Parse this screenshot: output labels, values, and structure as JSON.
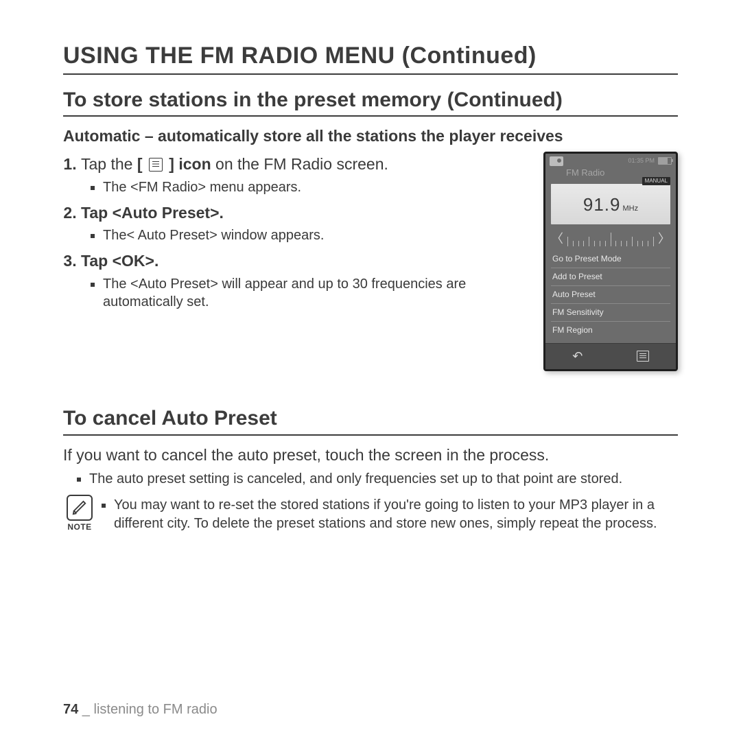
{
  "headings": {
    "page_title": "USING THE FM RADIO MENU (Continued)",
    "section1": "To store stations in the preset memory (Continued)",
    "section2": "To cancel Auto Preset"
  },
  "mode_line": "Automatic – automatically store all the stations the player receives",
  "steps": {
    "s1": {
      "num": "1.",
      "pre": "Tap the ",
      "icon_word": "icon",
      "bracket_open": "[",
      "bracket_close": "]",
      "post": " on the FM Radio screen.",
      "sub": "The <FM Radio> menu appears."
    },
    "s2": {
      "num": "2.",
      "main_a": "Tap ",
      "main_b": "<Auto Preset>",
      "main_c": ".",
      "sub": "The< Auto Preset> window appears."
    },
    "s3": {
      "num": "3.",
      "main_a": "Tap ",
      "main_b": "<OK>",
      "main_c": ".",
      "sub": "The <Auto Preset> will appear and up to 30 frequencies are automatically set."
    }
  },
  "cancel": {
    "body": "If you want to cancel the auto preset, touch the screen in the process.",
    "sub": "The auto preset setting is canceled, and only frequencies set up to that point are stored."
  },
  "note": {
    "label": "NOTE",
    "text": "You may want to re-set the stored stations if you're going to listen to your MP3 player in a different city. To delete the preset stations and store new ones, simply repeat the process."
  },
  "device": {
    "status_time": "01:35 PM",
    "title": "FM Radio",
    "manual_tag": "MANUAL",
    "freq": "91.9",
    "freq_unit": "MHz",
    "menu": [
      "Go to Preset Mode",
      "Add to Preset",
      "Auto Preset",
      "FM Sensitivity",
      "FM Region"
    ]
  },
  "footer": {
    "page_num": "74",
    "sep": " _ ",
    "chapter": "listening to FM radio"
  }
}
